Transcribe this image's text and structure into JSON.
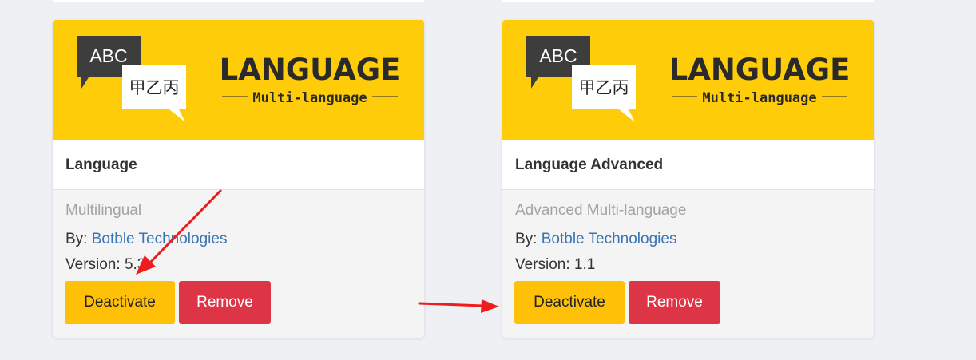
{
  "colors": {
    "page_background": "#eef0f4",
    "banner": "#fecc08",
    "deactivate_button": "#fec107",
    "remove_button": "#dd3545",
    "link": "#3a74b5",
    "annotation_arrow": "#ee1c1c"
  },
  "plugins": [
    {
      "banner": {
        "bubble_text": "ABC",
        "cjk_text": "甲乙丙",
        "heading": "LANGUAGE",
        "subheading": "Multi-language"
      },
      "title": "Language",
      "description": "Multilingual",
      "author_label": "By:",
      "author": "Botble Technologies",
      "version_label": "Version:",
      "version": "5.3",
      "deactivate_label": "Deactivate",
      "remove_label": "Remove"
    },
    {
      "banner": {
        "bubble_text": "ABC",
        "cjk_text": "甲乙丙",
        "heading": "LANGUAGE",
        "subheading": "Multi-language"
      },
      "title": "Language Advanced",
      "description": "Advanced Multi-language",
      "author_label": "By:",
      "author": "Botble Technologies",
      "version_label": "Version:",
      "version": "1.1",
      "deactivate_label": "Deactivate",
      "remove_label": "Remove"
    }
  ],
  "annotations": [
    {
      "name": "arrow-to-first-deactivate",
      "icon": "red-arrow-icon"
    },
    {
      "name": "arrow-to-second-deactivate",
      "icon": "red-arrow-icon"
    }
  ]
}
